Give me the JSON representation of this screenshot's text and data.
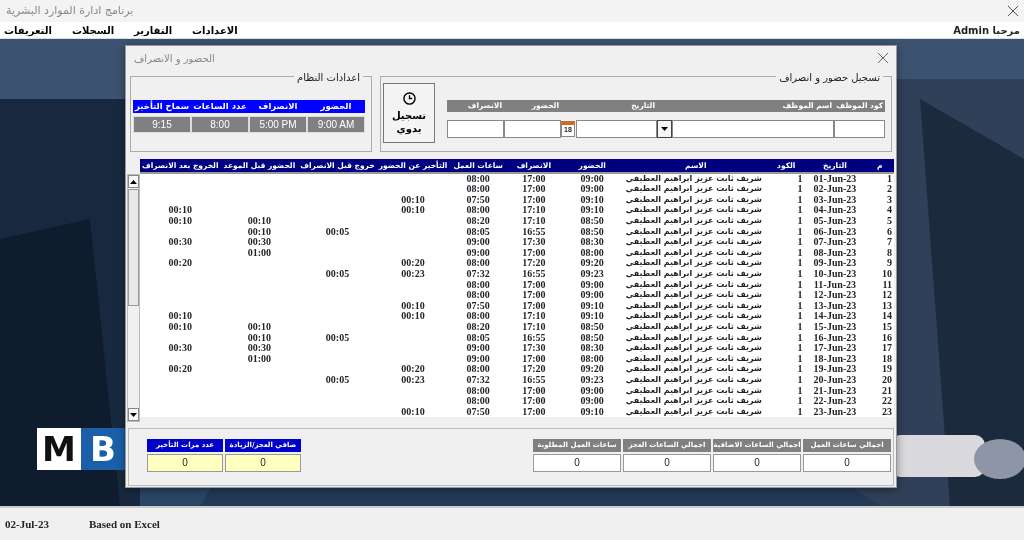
{
  "window": {
    "title": "برنامج ادارة الموارد البشرية"
  },
  "menu": [
    "الاعدادات",
    "التقارير",
    "السجلات",
    "التعريفات"
  ],
  "greeting": "مرحبا Admin",
  "logo": {
    "letters": [
      "B",
      "M"
    ]
  },
  "dialog": {
    "title": "الحضور و الانصراف",
    "system_settings": {
      "title": "اعدادات النظام",
      "fields": [
        {
          "label": "الحضور",
          "value": "9:00 AM"
        },
        {
          "label": "الانصراف",
          "value": "5:00 PM"
        },
        {
          "label": "عدد الساعات",
          "value": "8:00"
        },
        {
          "label": "سماح التأخير",
          "value": "9:15"
        }
      ]
    },
    "attendance_entry": {
      "title": "تسجيل حضور و انصراف",
      "manual_button": "تسجيل يدوي",
      "fields": [
        {
          "label": "كود الموظف",
          "kind": "text"
        },
        {
          "label": "اسم الموظف",
          "kind": "dropdown"
        },
        {
          "label": "التاريخ",
          "kind": "date",
          "calendar_day": "18"
        },
        {
          "label": "الحضور",
          "kind": "text"
        },
        {
          "label": "الانصراف",
          "kind": "text"
        }
      ]
    },
    "table": {
      "columns": [
        "م",
        "التاريخ",
        "الكود",
        "الاسم",
        "الحضور",
        "الانصراف",
        "ساعات العمل",
        "التأخير عن الحضور",
        "خروج قبل الانصراف",
        "الحضور قبل الموعد",
        "الخروج بعد الانصراف"
      ],
      "rows": [
        {
          "n": "1",
          "date": "01-Jun-23",
          "code": "1",
          "name": "شريف ثابت عزيز ابراهيم العطيفي",
          "in": "09:00",
          "out": "17:00",
          "work": "08:00"
        },
        {
          "n": "2",
          "date": "02-Jun-23",
          "code": "1",
          "name": "شريف ثابت عزيز ابراهيم العطيفي",
          "in": "09:00",
          "out": "17:00",
          "work": "08:00"
        },
        {
          "n": "3",
          "date": "03-Jun-23",
          "code": "1",
          "name": "شريف ثابت عزيز ابراهيم العطيفي",
          "in": "09:10",
          "out": "17:00",
          "work": "07:50",
          "late": "00:10"
        },
        {
          "n": "4",
          "date": "04-Jun-23",
          "code": "1",
          "name": "شريف ثابت عزيز ابراهيم العطيفي",
          "in": "09:10",
          "out": "17:10",
          "work": "08:00",
          "late": "00:10",
          "overtime": "00:10"
        },
        {
          "n": "5",
          "date": "05-Jun-23",
          "code": "1",
          "name": "شريف ثابت عزيز ابراهيم العطيفي",
          "in": "08:50",
          "out": "17:10",
          "work": "08:20",
          "early_in": "00:10",
          "overtime": "00:10"
        },
        {
          "n": "6",
          "date": "06-Jun-23",
          "code": "1",
          "name": "شريف ثابت عزيز ابراهيم العطيفي",
          "in": "08:50",
          "out": "16:55",
          "work": "08:05",
          "early_out": "00:05",
          "early_in": "00:10"
        },
        {
          "n": "7",
          "date": "07-Jun-23",
          "code": "1",
          "name": "شريف ثابت عزيز ابراهيم العطيفي",
          "in": "08:30",
          "out": "17:30",
          "work": "09:00",
          "early_in": "00:30",
          "overtime": "00:30"
        },
        {
          "n": "8",
          "date": "08-Jun-23",
          "code": "1",
          "name": "شريف ثابت عزيز ابراهيم العطيفي",
          "in": "08:00",
          "out": "17:00",
          "work": "09:00",
          "early_in": "01:00"
        },
        {
          "n": "9",
          "date": "09-Jun-23",
          "code": "1",
          "name": "شريف ثابت عزيز ابراهيم العطيفي",
          "in": "09:20",
          "out": "17:20",
          "work": "08:00",
          "late": "00:20",
          "overtime": "00:20"
        },
        {
          "n": "10",
          "date": "10-Jun-23",
          "code": "1",
          "name": "شريف ثابت عزيز ابراهيم العطيفي",
          "in": "09:23",
          "out": "16:55",
          "work": "07:32",
          "late": "00:23",
          "early_out": "00:05"
        },
        {
          "n": "11",
          "date": "11-Jun-23",
          "code": "1",
          "name": "شريف ثابت عزيز ابراهيم العطيفي",
          "in": "09:00",
          "out": "17:00",
          "work": "08:00"
        },
        {
          "n": "12",
          "date": "12-Jun-23",
          "code": "1",
          "name": "شريف ثابت عزيز ابراهيم العطيفي",
          "in": "09:00",
          "out": "17:00",
          "work": "08:00"
        },
        {
          "n": "13",
          "date": "13-Jun-23",
          "code": "1",
          "name": "شريف ثابت عزيز ابراهيم العطيفي",
          "in": "09:10",
          "out": "17:00",
          "work": "07:50",
          "late": "00:10"
        },
        {
          "n": "14",
          "date": "14-Jun-23",
          "code": "1",
          "name": "شريف ثابت عزيز ابراهيم العطيفي",
          "in": "09:10",
          "out": "17:10",
          "work": "08:00",
          "late": "00:10",
          "overtime": "00:10"
        },
        {
          "n": "15",
          "date": "15-Jun-23",
          "code": "1",
          "name": "شريف ثابت عزيز ابراهيم العطيفي",
          "in": "08:50",
          "out": "17:10",
          "work": "08:20",
          "early_in": "00:10",
          "overtime": "00:10"
        },
        {
          "n": "16",
          "date": "16-Jun-23",
          "code": "1",
          "name": "شريف ثابت عزيز ابراهيم العطيفي",
          "in": "08:50",
          "out": "16:55",
          "work": "08:05",
          "early_out": "00:05",
          "early_in": "00:10"
        },
        {
          "n": "17",
          "date": "17-Jun-23",
          "code": "1",
          "name": "شريف ثابت عزيز ابراهيم العطيفي",
          "in": "08:30",
          "out": "17:30",
          "work": "09:00",
          "early_in": "00:30",
          "overtime": "00:30"
        },
        {
          "n": "18",
          "date": "18-Jun-23",
          "code": "1",
          "name": "شريف ثابت عزيز ابراهيم العطيفي",
          "in": "08:00",
          "out": "17:00",
          "work": "09:00",
          "early_in": "01:00"
        },
        {
          "n": "19",
          "date": "19-Jun-23",
          "code": "1",
          "name": "شريف ثابت عزيز ابراهيم العطيفي",
          "in": "09:20",
          "out": "17:20",
          "work": "08:00",
          "late": "00:20",
          "overtime": "00:20"
        },
        {
          "n": "20",
          "date": "20-Jun-23",
          "code": "1",
          "name": "شريف ثابت عزيز ابراهيم العطيفي",
          "in": "09:23",
          "out": "16:55",
          "work": "07:32",
          "late": "00:23",
          "early_out": "00:05"
        },
        {
          "n": "21",
          "date": "21-Jun-23",
          "code": "1",
          "name": "شريف ثابت عزيز ابراهيم العطيفي",
          "in": "09:00",
          "out": "17:00",
          "work": "08:00"
        },
        {
          "n": "22",
          "date": "22-Jun-23",
          "code": "1",
          "name": "شريف ثابت عزيز ابراهيم العطيفي",
          "in": "09:00",
          "out": "17:00",
          "work": "08:00"
        },
        {
          "n": "23",
          "date": "23-Jun-23",
          "code": "1",
          "name": "شريف ثابت عزيز ابراهيم العطيفي",
          "in": "09:10",
          "out": "17:00",
          "work": "07:50",
          "late": "00:10"
        }
      ]
    },
    "totals": [
      {
        "label": "اجمالي ساعات العمل",
        "value": "0"
      },
      {
        "label": "اجمالي الساعات الاضافية",
        "value": "0"
      },
      {
        "label": "اجمالي الساعات العجز",
        "value": "0"
      },
      {
        "label": "ساعات العمل المطلوبة",
        "value": "0"
      }
    ],
    "late_summary": [
      {
        "label": "صافي العجز/الزيادة",
        "value": "0"
      },
      {
        "label": "عدد مرات التأخير",
        "value": "0"
      }
    ]
  },
  "status_bar": {
    "date": "02-Jul-23",
    "note": "Based on Excel"
  }
}
